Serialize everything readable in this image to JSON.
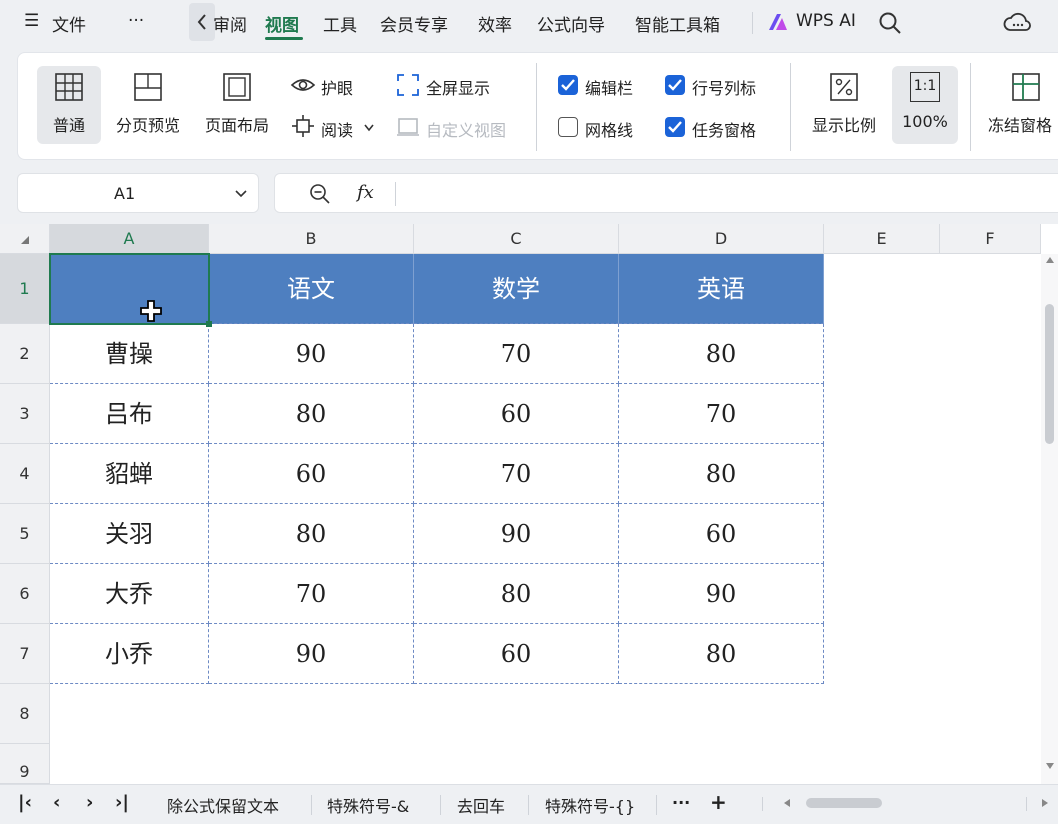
{
  "menu": {
    "hamburger": "☰",
    "file": "文件",
    "more": "···",
    "review_partial": "审阅",
    "view": "视图",
    "tools": "工具",
    "member": "会员专享",
    "efficiency": "效率",
    "formula_wizard": "公式向导",
    "smart_toolbox": "智能工具箱",
    "wps_ai": "WPS AI"
  },
  "ribbon": {
    "normal": "普通",
    "page_break_preview": "分页预览",
    "page_layout": "页面布局",
    "eye_protection": "护眼",
    "reading": "阅读",
    "fullscreen": "全屏显示",
    "custom_view": "自定义视图",
    "formula_bar": "编辑栏",
    "gridlines": "网格线",
    "row_col_headers": "行号列标",
    "task_pane": "任务窗格",
    "zoom_ratio": "显示比例",
    "zoom_100": "100%",
    "zoom_11_icon": "1:1",
    "freeze_panes": "冻结窗格"
  },
  "checks": {
    "formula_bar": true,
    "gridlines": false,
    "row_col_headers": true,
    "task_pane": true
  },
  "formula": {
    "cell_ref": "A1",
    "fx": "fx",
    "value": ""
  },
  "grid": {
    "columns": [
      "A",
      "B",
      "C",
      "D",
      "E",
      "F"
    ],
    "rows": [
      "1",
      "2",
      "3",
      "4",
      "5",
      "6",
      "7",
      "8",
      "9"
    ],
    "header": [
      "",
      "语文",
      "数学",
      "英语"
    ],
    "data": [
      [
        "曹操",
        "90",
        "70",
        "80"
      ],
      [
        "吕布",
        "80",
        "60",
        "70"
      ],
      [
        "貂蝉",
        "60",
        "70",
        "80"
      ],
      [
        "关羽",
        "80",
        "90",
        "60"
      ],
      [
        "大乔",
        "70",
        "80",
        "90"
      ],
      [
        "小乔",
        "90",
        "60",
        "80"
      ]
    ]
  },
  "tabs": {
    "first": "|‹",
    "prev": "‹",
    "next": "›",
    "last": "›|",
    "items": [
      "除公式保留文本",
      "特殊符号-&",
      "去回车",
      "特殊符号-{}"
    ],
    "more": "···",
    "add": "+"
  },
  "colors": {
    "header_fill": "#4e7fc0",
    "accent": "#1f7a4f",
    "checkbox": "#1b63d8"
  }
}
